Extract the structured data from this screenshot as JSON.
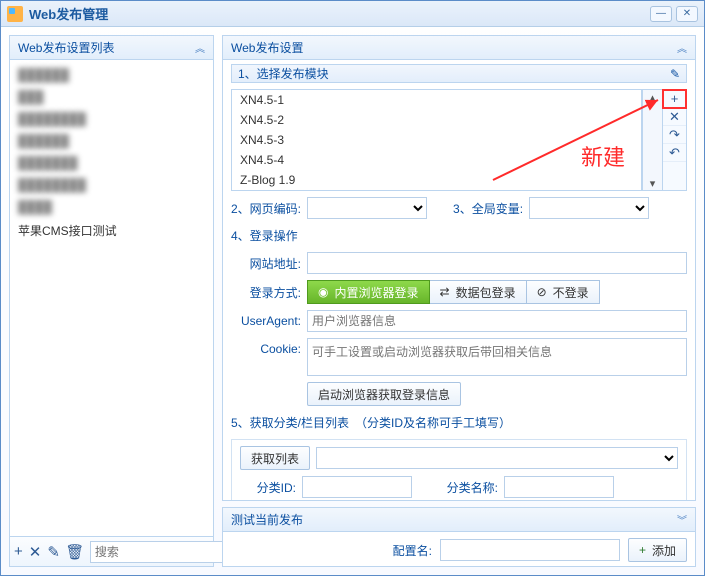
{
  "window": {
    "title": "Web发布管理"
  },
  "leftPanel": {
    "header": "Web发布设置列表",
    "items": [
      {
        "blur": true,
        "text": "██████"
      },
      {
        "blur": true,
        "text": "███"
      },
      {
        "blur": true,
        "text": "████████"
      },
      {
        "blur": true,
        "text": "██████"
      },
      {
        "blur": true,
        "text": "███████"
      },
      {
        "blur": true,
        "text": "████████"
      },
      {
        "blur": true,
        "text": "████"
      },
      {
        "blur": false,
        "text": "苹果CMS接口测试"
      }
    ],
    "searchPlaceholder": "搜索"
  },
  "settings": {
    "header": "Web发布设置",
    "step1": "1、选择发布模块",
    "modules": [
      "XN4.5-1",
      "XN4.5-2",
      "XN4.5-3",
      "XN4.5-4",
      "Z-Blog 1.9"
    ],
    "step2": "2、网页编码:",
    "step3": "3、全局变量:",
    "step4": "4、登录操作",
    "urlLabel": "网站地址:",
    "loginLabel": "登录方式:",
    "loginBuiltin": "内置浏览器登录",
    "loginPacket": "数据包登录",
    "loginNone": "不登录",
    "uaLabel": "UserAgent:",
    "uaPlaceholder": "用户浏览器信息",
    "cookieLabel": "Cookie:",
    "cookiePlaceholder": "可手工设置或启动浏览器获取后带回相关信息",
    "launchBrowser": "启动浏览器获取登录信息",
    "step5": "5、获取分类/栏目列表",
    "step5hint": "（分类ID及名称可手工填写）",
    "getList": "获取列表",
    "catId": "分类ID:",
    "catName": "分类名称:"
  },
  "test": {
    "header": "测试当前发布"
  },
  "footer": {
    "configLabel": "配置名:",
    "addBtn": "添加"
  },
  "annotation": {
    "text": "新建"
  },
  "icons": {
    "globe": "◉",
    "shuffle": "✕",
    "ban": "⊘",
    "plus": "+",
    "x": "✕",
    "pencil": "✎",
    "trash": "🗑",
    "redo": "↷",
    "undo": "↶"
  }
}
